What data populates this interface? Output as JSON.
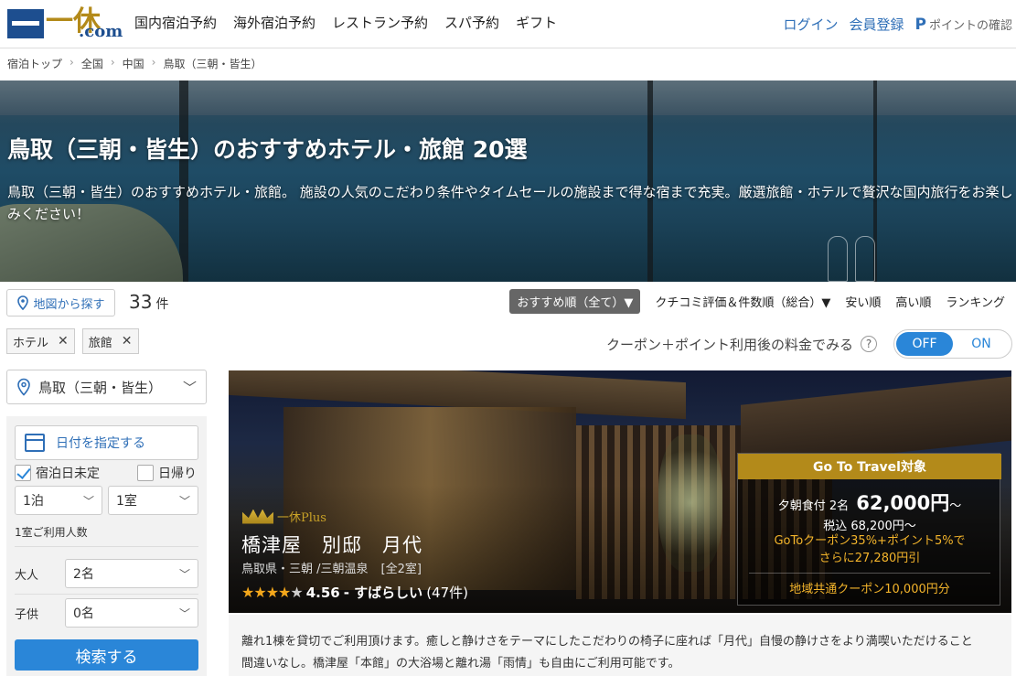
{
  "header": {
    "logo_kanji": "一休",
    "logo_domain": ".com",
    "nav": [
      "国内宿泊予約",
      "海外宿泊予約",
      "レストラン予約",
      "スパ予約",
      "ギフト"
    ],
    "login": "ログイン",
    "register": "会員登録",
    "points_icon": "P",
    "points": "ポイントの確認"
  },
  "breadcrumb": [
    "宿泊トップ",
    "全国",
    "中国",
    "鳥取（三朝・皆生）"
  ],
  "hero": {
    "title": "鳥取（三朝・皆生）のおすすめホテル・旅館 20選",
    "text": "鳥取（三朝・皆生）のおすすめホテル・旅館。 施設の人気のこだわり条件やタイムセールの施設まで得な宿まで充実。厳選旅館・ホテルで贅沢な国内旅行をお楽しみください！"
  },
  "results": {
    "map_button": "地図から探す",
    "count": "33",
    "count_unit": "件"
  },
  "sort": {
    "options": [
      "おすすめ順（全て）▼",
      "クチコミ評価＆件数順（総合）▼",
      "安い順",
      "高い順",
      "ランキング"
    ],
    "active_index": 0
  },
  "filters": [
    "ホテル",
    "館"
  ],
  "filter_labels": [
    "ホテル",
    "旅館"
  ],
  "coupon": {
    "label": "クーポン＋ポイント利用後の料金でみる",
    "help": "?",
    "off": "OFF",
    "on": "ON"
  },
  "sidebar": {
    "location": "鳥取（三朝・皆生）",
    "date_button": "日付を指定する",
    "undecided": "宿泊日未定",
    "daytrip": "日帰り",
    "nights": "1泊",
    "rooms": "1室",
    "guests_label": "1室ご利用人数",
    "adult_label": "大人",
    "adult_value": "2名",
    "child_label": "子供",
    "child_value": "0名",
    "search": "検索する"
  },
  "hotel": {
    "badge": "一休Plus",
    "name": "橋津屋　別邸　月代",
    "area": "鳥取県・三朝 /三朝温泉",
    "rooms": "[全2室]",
    "rating": "4.56",
    "rating_word": "- すばらしい",
    "reviews": "(47件)",
    "rating_fraction": 0.91,
    "goto_tag": "Go To Travel対象",
    "plan": "夕朝食付 2名",
    "price": "62,000円",
    "price_suffix": "〜",
    "tax_price": "税込 68,200円〜",
    "goto_line1": "GoToクーポン35%+ポイント5%で",
    "goto_line2": "さらに27,280円引",
    "regional": "地域共通クーポン10,000円分",
    "description_1": "離れ1棟を貸切でご利用頂けます。癒しと静けさをテーマにしたこだわりの椅子に座れば「月代」自慢の静けさをより満喫いただけること",
    "description_2": "間違いなし。橋津屋「本館」の大浴場と離れ湯「雨情」も自由にご利用可能です。"
  }
}
